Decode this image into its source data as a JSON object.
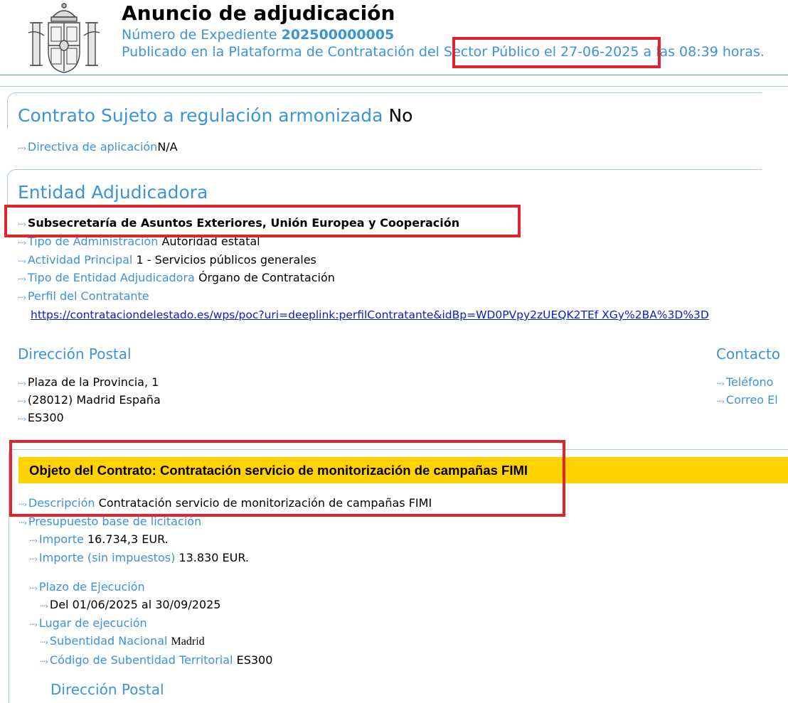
{
  "header": {
    "title": "Anuncio de adjudicación",
    "expediente_label": "Número de Expediente",
    "expediente_number": "202500000005",
    "published": "Publicado en la Plataforma de Contratación del Sector Público el 27-06-2025 a las 08:39 horas."
  },
  "regulacion": {
    "title": "Contrato Sujeto a regulación armonizada",
    "value": "No",
    "directiva_label": "Directiva de aplicación",
    "directiva_value": "N/A"
  },
  "entidad": {
    "title": "Entidad Adjudicadora",
    "name": "Subsecretaría de Asuntos Exteriores, Unión Europea y Cooperación",
    "tipo_admin_label": "Tipo de Administración",
    "tipo_admin_value": "Autoridad estatal",
    "actividad_label": "Actividad Principal",
    "actividad_value": "1 - Servicios públicos generales",
    "tipo_entidad_label": "Tipo de Entidad Adjudicadora",
    "tipo_entidad_value": "Órgano de Contratación",
    "perfil_label": "Perfil del Contratante",
    "perfil_url": "https://contrataciondelestado.es/wps/poc?uri=deeplink:perfilContratante&idBp=WD0PVpy2zUEQK2TEf XGy%2BA%3D%3D"
  },
  "direccion": {
    "title": "Dirección Postal",
    "line1": "Plaza de la Provincia, 1",
    "line2": "(28012) Madrid España",
    "line3": "ES300"
  },
  "contacto": {
    "title": "Contacto",
    "telefono_label": "Teléfono",
    "correo_label": "Correo El"
  },
  "objeto": {
    "banner": "Objeto del Contrato: Contratación servicio de monitorización de campañas FIMI",
    "descripcion_label": "Descripción",
    "descripcion_value": "Contratación servicio de monitorización de campañas FIMI",
    "presupuesto_label": "Presupuesto base de licitación",
    "importe_label": "Importe",
    "importe_value": "16.734,3 EUR.",
    "importe_sin_label": "Importe (sin impuestos)",
    "importe_sin_value": "13.830 EUR.",
    "plazo_label": "Plazo de Ejecución",
    "plazo_value": "Del 01/06/2025 al 30/09/2025",
    "lugar_label": "Lugar de ejecución",
    "subentidad_label": "Subentidad Nacional",
    "subentidad_value": "Madrid",
    "codigo_label": "Código de Subentidad Territorial",
    "codigo_value": "ES300",
    "direccion_title": "Dirección Postal"
  },
  "colors": {
    "accent": "#3c93d8",
    "banner": "#ffd200",
    "highlight": "#e2232c",
    "link": "#0b20c8"
  }
}
